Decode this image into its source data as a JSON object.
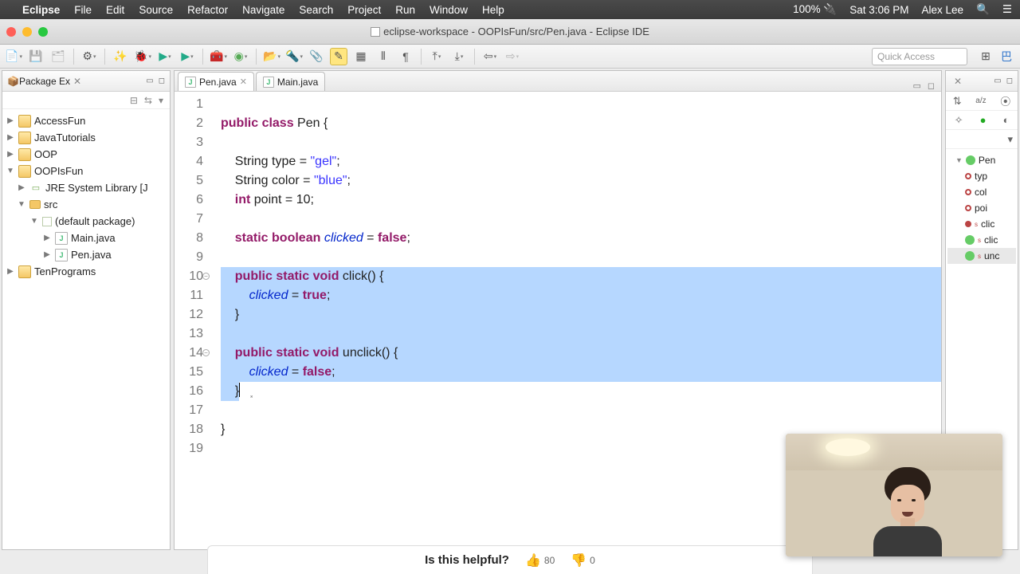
{
  "menubar": {
    "app": "Eclipse",
    "items": [
      "File",
      "Edit",
      "Source",
      "Refactor",
      "Navigate",
      "Search",
      "Project",
      "Run",
      "Window",
      "Help"
    ],
    "battery": "100%",
    "clock": "Sat 3:06 PM",
    "user": "Alex Lee"
  },
  "window": {
    "title": "eclipse-workspace - OOPIsFun/src/Pen.java - Eclipse IDE"
  },
  "toolbar": {
    "quick_access_placeholder": "Quick Access"
  },
  "package_explorer": {
    "title": "Package Ex",
    "projects": [
      {
        "name": "AccessFun",
        "open": false
      },
      {
        "name": "JavaTutorials",
        "open": false
      },
      {
        "name": "OOP",
        "open": false
      },
      {
        "name": "OOPIsFun",
        "open": true,
        "children": [
          {
            "name": "JRE System Library [J",
            "type": "lib"
          },
          {
            "name": "src",
            "type": "srcfolder",
            "open": true,
            "children": [
              {
                "name": "(default package)",
                "type": "pkg",
                "open": true,
                "children": [
                  {
                    "name": "Main.java",
                    "type": "java"
                  },
                  {
                    "name": "Pen.java",
                    "type": "java"
                  }
                ]
              }
            ]
          }
        ]
      },
      {
        "name": "TenPrograms",
        "open": false
      }
    ]
  },
  "editor": {
    "tabs": [
      {
        "label": "Pen.java",
        "active": true
      },
      {
        "label": "Main.java",
        "active": false
      }
    ],
    "lines": [
      {
        "n": 1,
        "html": ""
      },
      {
        "n": 2,
        "html": "<span class='kw'>public</span> <span class='kw'>class</span> Pen {"
      },
      {
        "n": 3,
        "html": ""
      },
      {
        "n": 4,
        "html": "    String type = <span class='str'>\"gel\"</span>;"
      },
      {
        "n": 5,
        "html": "    String color = <span class='str'>\"blue\"</span>;"
      },
      {
        "n": 6,
        "html": "    <span class='kw'>int</span> point = 10;"
      },
      {
        "n": 7,
        "html": ""
      },
      {
        "n": 8,
        "html": "    <span class='kw'>static</span> <span class='kw'>boolean</span> <span class='fld'>clicked</span> = <span class='bool'>false</span>;"
      },
      {
        "n": 9,
        "html": ""
      },
      {
        "n": 10,
        "html": "    <span class='kw'>public</span> <span class='kw'>static</span> <span class='kw'>void</span> click() {",
        "fold": true,
        "sel": true
      },
      {
        "n": 11,
        "html": "        <span class='fld'>clicked</span> = <span class='bool'>true</span>;",
        "sel": true
      },
      {
        "n": 12,
        "html": "    }",
        "sel": true
      },
      {
        "n": 13,
        "html": "",
        "sel": true
      },
      {
        "n": 14,
        "html": "    <span class='kw'>public</span> <span class='kw'>static</span> <span class='kw'>void</span> unclick() {",
        "fold": true,
        "sel": true
      },
      {
        "n": 15,
        "html": "        <span class='fld'>clicked</span> = <span class='bool'>false</span>;",
        "sel": true
      },
      {
        "n": 16,
        "html": "    }<span class='cursor'></span>   <span class='caret-brace'>}</span>",
        "selpartial": true
      },
      {
        "n": 17,
        "html": ""
      },
      {
        "n": 18,
        "html": "}"
      },
      {
        "n": 19,
        "html": ""
      }
    ]
  },
  "outline": {
    "items": [
      {
        "label": "Pen",
        "kind": "class"
      },
      {
        "label": "typ",
        "kind": "fld"
      },
      {
        "label": "col",
        "kind": "fld"
      },
      {
        "label": "poi",
        "kind": "fld"
      },
      {
        "label": "clic",
        "kind": "sfld",
        "s": true
      },
      {
        "label": "clic",
        "kind": "meth",
        "s": true
      },
      {
        "label": "unc",
        "kind": "meth",
        "s": true,
        "hl": true
      }
    ]
  },
  "helpful": {
    "question": "Is this helpful?",
    "up": "80",
    "down": "0"
  }
}
